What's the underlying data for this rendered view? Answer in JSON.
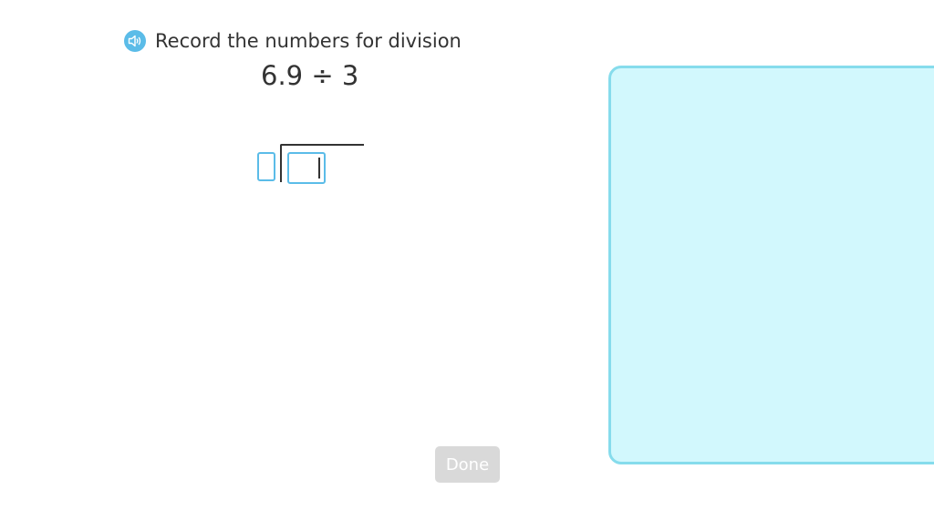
{
  "instruction": {
    "text": "Record the numbers for division",
    "audio_icon": "speaker-icon"
  },
  "problem": {
    "expression": "6.9 ÷ 3"
  },
  "division": {
    "divisor_value": "",
    "dividend_value": ""
  },
  "controls": {
    "done_label": "Done"
  },
  "colors": {
    "accent": "#5bbce8",
    "panel_fill": "#d2f8fd",
    "panel_border": "#86dcec",
    "done_disabled": "#d9d9d9"
  }
}
